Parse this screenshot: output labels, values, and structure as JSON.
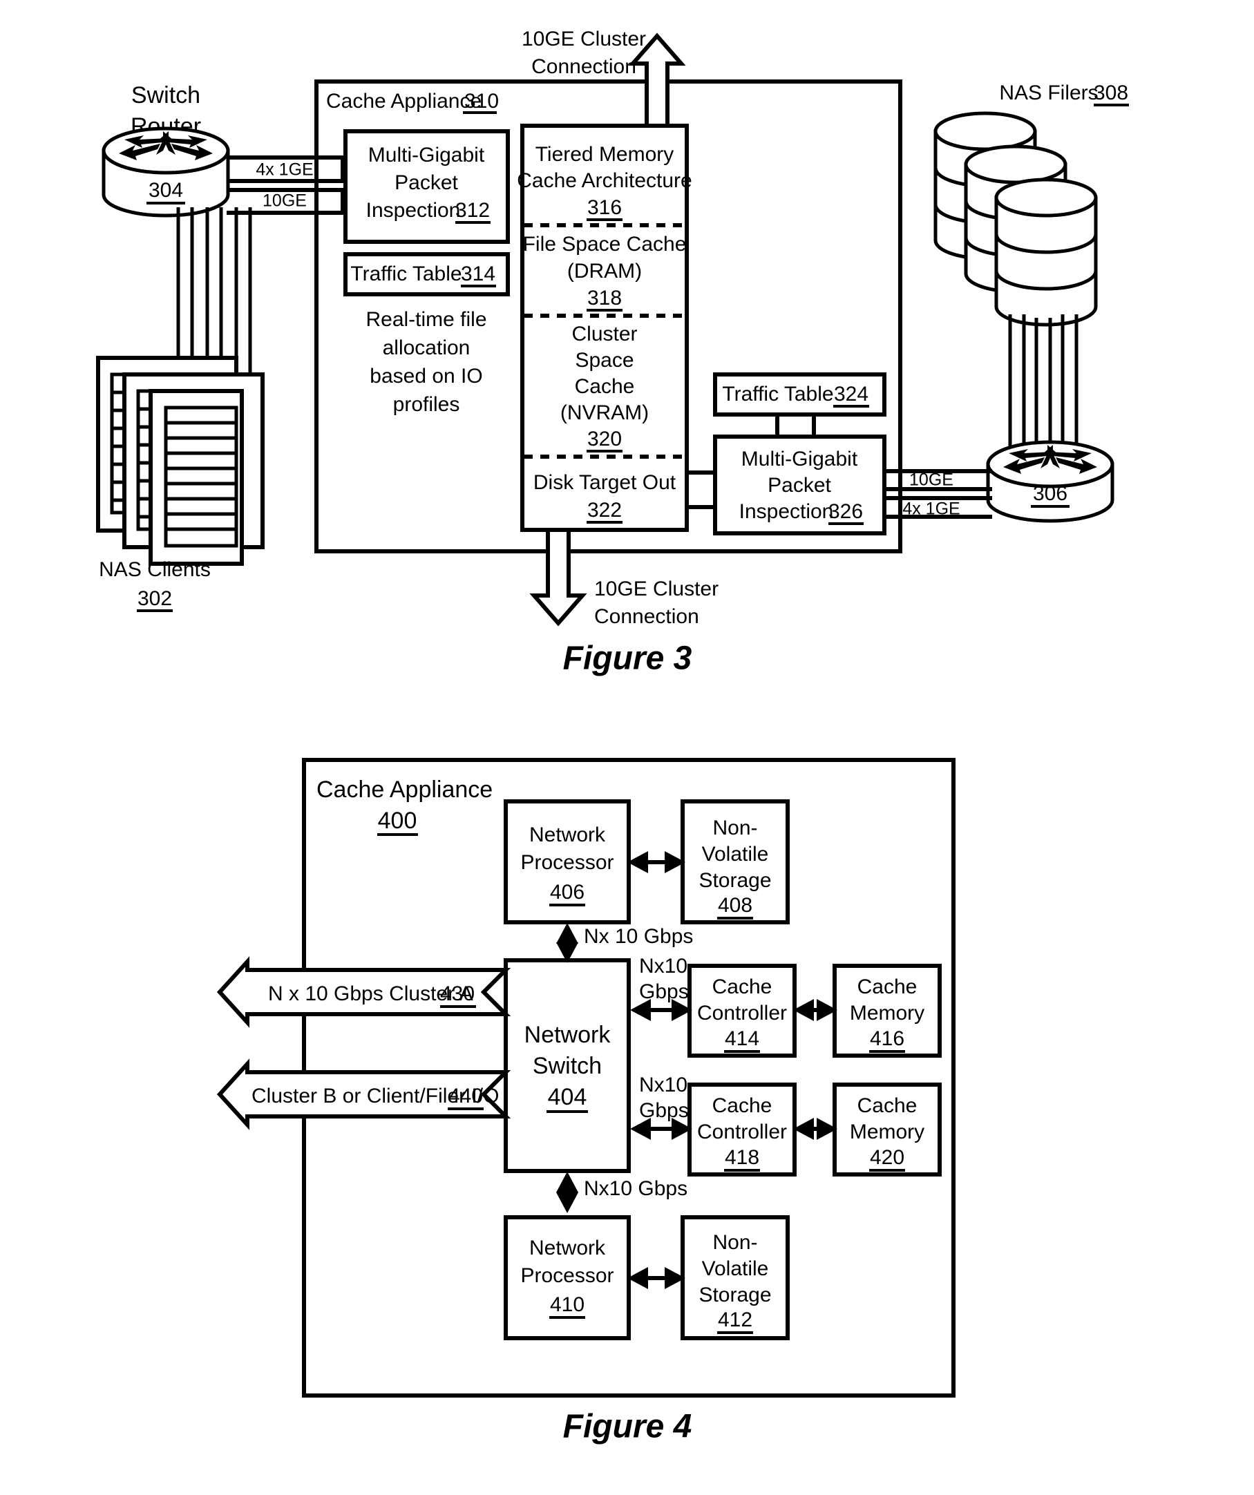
{
  "figure3": {
    "caption": "Figure 3",
    "top_connection": {
      "line1": "10GE Cluster",
      "line2": "Connection"
    },
    "bottom_connection": {
      "line1": "10GE Cluster",
      "line2": "Connection"
    },
    "switch_router": {
      "line1": "Switch",
      "line2": "Router",
      "ref": "304"
    },
    "nas_clients": {
      "label": "NAS Clients",
      "ref": "302"
    },
    "nas_filers": {
      "label": "NAS Filers",
      "ref": "308"
    },
    "right_switch": {
      "ref": "306"
    },
    "appliance": {
      "label": "Cache Appliance",
      "ref": "310"
    },
    "left_links": {
      "upper": "4x 1GE",
      "lower": "10GE"
    },
    "right_links": {
      "upper": "10GE",
      "lower": "4x 1GE"
    },
    "mgpi_left": {
      "line1": "Multi-Gigabit",
      "line2": "Packet",
      "line3": "Inspection",
      "ref": "312"
    },
    "traffic_table_left": {
      "label": "Traffic Table",
      "ref": "314"
    },
    "note": {
      "line1": "Real-time file",
      "line2": "allocation",
      "line3": "based on IO",
      "line4": "profiles"
    },
    "traffic_table_right": {
      "label": "Traffic Table",
      "ref": "324"
    },
    "mgpi_right": {
      "line1": "Multi-Gigabit",
      "line2": "Packet",
      "line3": "Inspection",
      "ref": "326"
    },
    "cache_stack": [
      {
        "lines": [
          "Tiered Memory",
          "Cache Architecture"
        ],
        "ref": "316"
      },
      {
        "lines": [
          "File Space Cache",
          "(DRAM)"
        ],
        "ref": "318"
      },
      {
        "lines": [
          "Cluster",
          "Space",
          "Cache",
          "(NVRAM)"
        ],
        "ref": "320"
      },
      {
        "lines": [
          "Disk Target Out"
        ],
        "ref": "322"
      }
    ]
  },
  "figure4": {
    "caption": "Figure 4",
    "appliance": {
      "label": "Cache Appliance",
      "ref": "400"
    },
    "network_switch": {
      "line1": "Network",
      "line2": "Switch",
      "ref": "404"
    },
    "network_processor_top": {
      "line1": "Network",
      "line2": "Processor",
      "ref": "406"
    },
    "nvs_top": {
      "line1": "Non-",
      "line2": "Volatile",
      "line3": "Storage",
      "ref": "408"
    },
    "network_processor_bottom": {
      "line1": "Network",
      "line2": "Processor",
      "ref": "410"
    },
    "nvs_bottom": {
      "line1": "Non-",
      "line2": "Volatile",
      "line3": "Storage",
      "ref": "412"
    },
    "cache_controller_top": {
      "line1": "Cache",
      "line2": "Controller",
      "ref": "414"
    },
    "cache_memory_top": {
      "line1": "Cache",
      "line2": "Memory",
      "ref": "416"
    },
    "cache_controller_bottom": {
      "line1": "Cache",
      "line2": "Controller",
      "ref": "418"
    },
    "cache_memory_bottom": {
      "line1": "Cache",
      "line2": "Memory",
      "ref": "420"
    },
    "link_np_top": "Nx 10 Gbps",
    "link_np_bottom": "Nx10 Gbps",
    "link_cc_top": {
      "line1": "Nx10",
      "line2": "Gbps"
    },
    "link_cc_bottom": {
      "line1": "Nx10",
      "line2": "Gbps"
    },
    "cluster_a": {
      "label": "N x 10 Gbps Cluster A",
      "ref": "430"
    },
    "cluster_b": {
      "label": "Cluster B or Client/Filer I/O",
      "ref": "440"
    }
  }
}
